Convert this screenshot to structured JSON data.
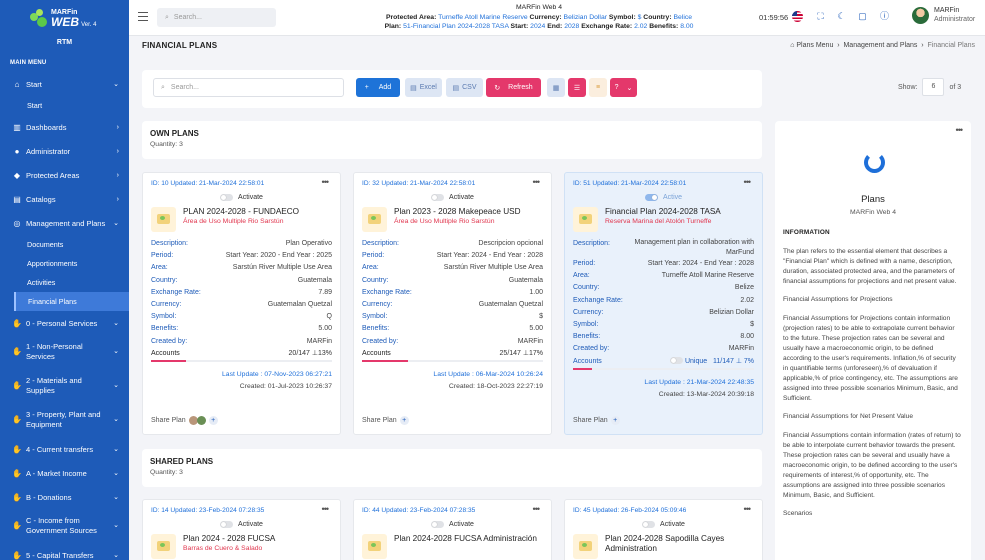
{
  "app": {
    "logo_top": "MARFin",
    "logo_main": "WEB",
    "logo_ver": "Ver. 4",
    "org": "RTM",
    "main_menu": "MAIN MENU"
  },
  "menu": [
    {
      "label": "Start",
      "icon": "home-icon"
    },
    {
      "label": "Dashboards",
      "icon": "chart-icon"
    },
    {
      "label": "Administrator",
      "icon": "user-icon"
    },
    {
      "label": "Protected Areas",
      "icon": "map-icon"
    },
    {
      "label": "Catalogs",
      "icon": "folder-icon"
    },
    {
      "label": "Management and Plans",
      "icon": "target-icon"
    },
    {
      "label": "0 - Personal Services",
      "icon": "hand-coins-icon"
    },
    {
      "label": "1 - Non-Personal Services",
      "icon": "hand-coins-icon"
    },
    {
      "label": "2 - Materials and Supplies",
      "icon": "hand-coins-icon"
    },
    {
      "label": "3 - Property, Plant and Equipment",
      "icon": "hand-coins-icon"
    },
    {
      "label": "4 - Current transfers",
      "icon": "hand-coins-icon"
    },
    {
      "label": "A - Market Income",
      "icon": "hand-coins-icon"
    },
    {
      "label": "B - Donations",
      "icon": "hand-coins-icon"
    },
    {
      "label": "C - Income from Government Sources",
      "icon": "hand-coins-icon"
    },
    {
      "label": "5 - Capital Transfers",
      "icon": "hand-coins-icon"
    }
  ],
  "submenu_start": "Start",
  "submenu_mgmt": [
    "Documents",
    "Apportionments",
    "Activities",
    "Financial Plans"
  ],
  "topbar": {
    "search_placeholder": "Search...",
    "line1": "MARFin Web 4",
    "pa_label": "Protected Area:",
    "pa_value": "Turneffe Atoll Marine Reserve",
    "cur_label": "Currency:",
    "cur_value": "Belizian Dollar",
    "sym_label": "Symbol:",
    "sym_value": "$",
    "country_label": "Country:",
    "country_value": "Belice",
    "plan_label": "Plan:",
    "plan_value": "51-Financial Plan 2024-2028 TASA",
    "start_label": "Start:",
    "start_value": "2024",
    "end_label": "End:",
    "end_value": "2028",
    "rate_label": "Exchange Rate:",
    "rate_value": "2.02",
    "ben_label": "Benefits:",
    "ben_value": "8.00",
    "clock": "01:59:56",
    "user_name": "MARFin",
    "user_role": "Administrator"
  },
  "page": {
    "title": "FINANCIAL PLANS",
    "crumbs": [
      "Plans Menu",
      "Management and Plans",
      "Financial Plans"
    ]
  },
  "toolbar": {
    "search_placeholder": "Search...",
    "add": "Add",
    "excel": "Excel",
    "csv": "CSV",
    "refresh": "Refresh",
    "help": "?",
    "show_label": "Show:",
    "show_value": "6",
    "of_label": "of 3"
  },
  "own": {
    "title": "OWN PLANS",
    "quantity": "Quantity: 3"
  },
  "shared": {
    "title": "SHARED PLANS",
    "quantity": "Quantity: 3"
  },
  "labels": {
    "description": "Description:",
    "period": "Period:",
    "area": "Area:",
    "country": "Country:",
    "exchange_rate": "Exchange Rate:",
    "currency": "Currency:",
    "symbol": "Symbol:",
    "benefits": "Benefits:",
    "created_by": "Created by:",
    "accounts": "Accounts",
    "activate": "Activate",
    "active": "Active",
    "share_plan": "Share Plan",
    "unique": "Unique"
  },
  "own_cards": [
    {
      "id_line": "ID: 10 Updated: 21-Mar-2024 22:58:01",
      "name": "PLAN 2024-2028 - FUNDAECO",
      "area_name": "Área de Uso Multiple Rio Sarstún",
      "description": "Plan Operativo",
      "period": "Start Year: 2020 - End Year : 2025",
      "area": "Sarstún River Multiple Use Area",
      "country": "Guatemala",
      "exchange_rate": "7.89",
      "currency": "Guatemalan Quetzal",
      "symbol": "Q",
      "benefits": "5.00",
      "created_by": "MARFin",
      "accounts": "20/147 ⊥13%",
      "accounts_pct": 0.13,
      "last_update": "Last Update : 07-Nov-2023 06:27:21",
      "created": "Created: 01-Jul-2023 10:26:37"
    },
    {
      "id_line": "ID: 32 Updated: 21-Mar-2024 22:58:01",
      "name": "Plan 2023 - 2028 Makepeace USD",
      "area_name": "Área de Uso Multiple Rio Sarstún",
      "description": "Descripcion opcional",
      "period": "Start Year: 2024 - End Year : 2028",
      "area": "Sarstún River Multiple Use Area",
      "country": "Guatemala",
      "exchange_rate": "1.00",
      "currency": "Guatemalan Quetzal",
      "symbol": "$",
      "benefits": "5.00",
      "created_by": "MARFin",
      "accounts": "25/147 ⊥17%",
      "accounts_pct": 0.17,
      "last_update": "Last Update : 06-Mar-2024 10:26:24",
      "created": "Created: 18-Oct-2023 22:27:19"
    },
    {
      "id_line": "ID: 51 Updated: 21-Mar-2024 22:58:01",
      "name": "Financial Plan 2024-2028 TASA",
      "area_name": "Reserva Marina del Atolón Turneffe",
      "description": "Management plan in collaboration with MarFund",
      "period": "Start Year: 2024 - End Year : 2028",
      "area": "Turneffe Atoll Marine Reserve",
      "country": "Belize",
      "exchange_rate": "2.02",
      "currency": "Belizian Dollar",
      "symbol": "$",
      "benefits": "8.00",
      "created_by": "MARFin",
      "accounts": "11/147 ⊥ 7%",
      "accounts_pct": 0.07,
      "last_update": "Last Update : 21-Mar-2024 22:48:35",
      "created": "Created: 13-Mar-2024 20:39:18"
    }
  ],
  "shared_cards": [
    {
      "id_line": "ID: 14 Updated: 23-Feb-2024 07:28:35",
      "name": "Plan 2024 - 2028 FUCSA",
      "area_name": "Barras de Cuero & Salado"
    },
    {
      "id_line": "ID: 44 Updated: 23-Feb-2024 07:28:35",
      "name": "Plan 2024-2028 FUCSA Administración",
      "area_name": ""
    },
    {
      "id_line": "ID: 45 Updated: 26-Feb-2024 05:09:46",
      "name": "Plan 2024-2028 Sapodilla Cayes Administration",
      "area_name": ""
    }
  ],
  "info": {
    "title": "Plans",
    "subtitle": "MARFin Web 4",
    "h1": "INFORMATION",
    "p1": "The plan refers to the essential element that describes a \"Financial Plan\" which is defined with a name, description, duration, associated protected area, and the parameters of financial assumptions for projections and net present value.",
    "p2": "Financial Assumptions for Projections",
    "p3": "Financial Assumptions for Projections contain information (projection rates) to be able to extrapolate current behavior to the future. These projection rates can be several and usually have a macroeconomic origin, to be defined according to the user's requirements. Inflation,% of security in quantifiable terms (unforeseen),% of devaluation if applicable,% of price contingency, etc. The assumptions are assigned into three possible scenarios Minimum, Basic, and Sufficient.",
    "p4": "Financial Assumptions for Net Present Value",
    "p5": "Financial Assumptions contain information (rates of return) to be able to interpolate current behavior towards the present. These projection rates can be several and usually have a macroeconomic origin, to be defined according to the user's requirements of interest,% of opportunity, etc. The assumptions are assigned into three possible scenarios Minimum, Basic, and Sufficient.",
    "p6": "Scenarios"
  },
  "colors": {
    "sidebar": "#1e5bb8",
    "accent": "#1e73d8",
    "danger": "#e4386b"
  }
}
